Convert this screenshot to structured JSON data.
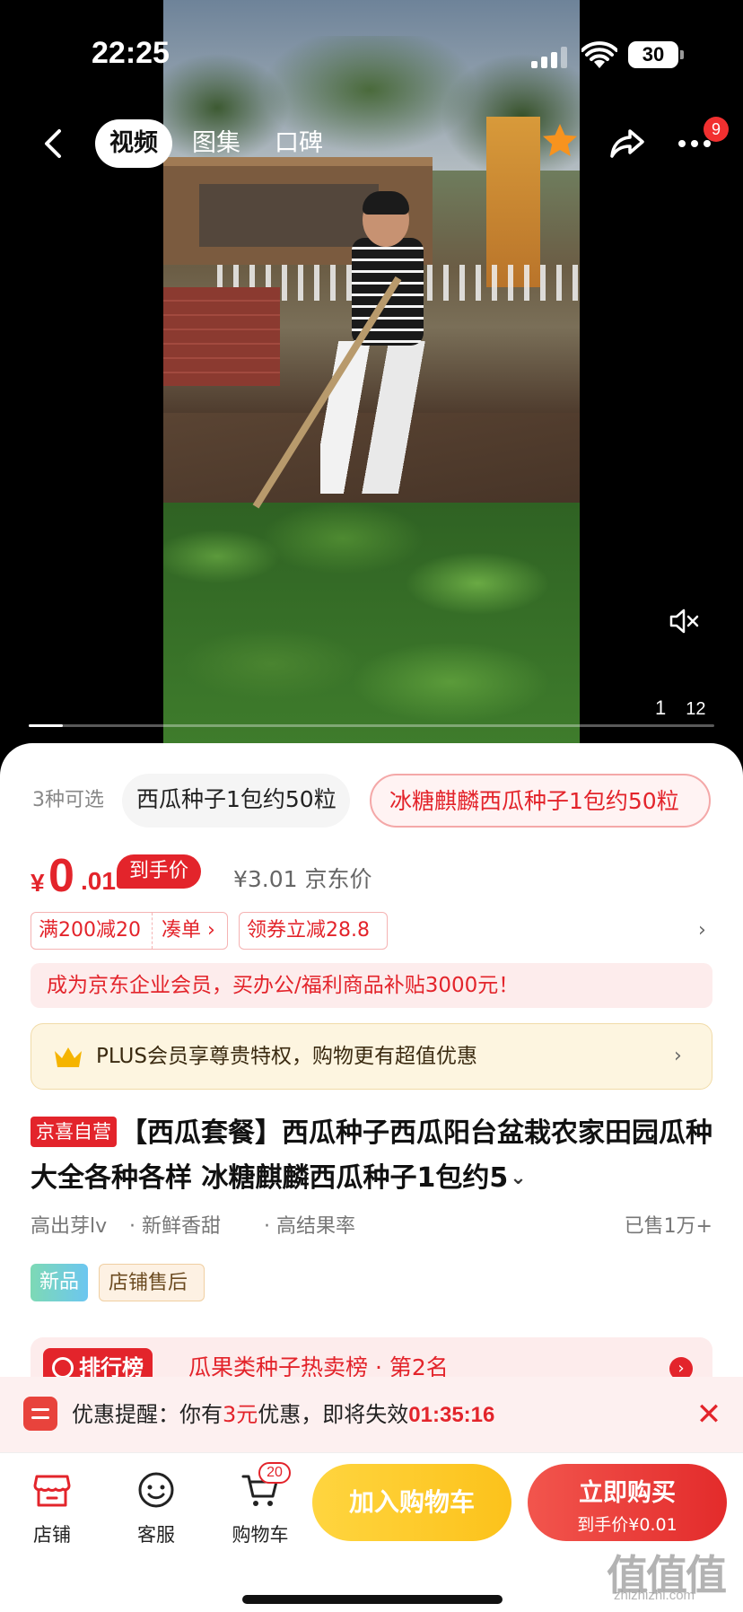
{
  "status_bar": {
    "time": "22:25",
    "battery": "30"
  },
  "nav": {
    "tabs": [
      {
        "label": "视频",
        "active": true
      },
      {
        "label": "图集",
        "active": false
      },
      {
        "label": "口碑",
        "active": false
      }
    ],
    "more_badge": "9"
  },
  "video": {
    "progress_fraction": 0.05,
    "page_current": "1",
    "page_total": "12"
  },
  "variants": {
    "count_label": "3种可选",
    "option1": "西瓜种子1包约50粒",
    "option2": "冰糖麒麟西瓜种子1包约50粒"
  },
  "price": {
    "symbol": "¥",
    "integer": "0",
    "decimal": ".01",
    "tag": "到手价",
    "reference": "¥3.01 京东价"
  },
  "promos": {
    "full_reduction": "满200减20",
    "combine": "凑单 ›",
    "coupon": "领券立减28.8",
    "arrow": "›"
  },
  "enterprise_banner": "成为京东企业会员，买办公/福利商品补贴3000元！",
  "plus_banner": {
    "text": "PLUS会员享尊贵特权，购物更有超值优惠",
    "arrow": "›"
  },
  "product": {
    "self_badge": "京喜自营",
    "title": "【西瓜套餐】西瓜种子西瓜阳台盆栽农家田园瓜种大全各种各样 冰糖麒麟西瓜种子1包约5",
    "expand": "⌄"
  },
  "features": {
    "f1": "高出芽lv",
    "f2": "· 新鲜香甜",
    "f3": "· 高结果率",
    "sold": "已售1万+"
  },
  "tags": {
    "new": "新品",
    "after_sale": "店铺售后"
  },
  "ranking": {
    "badge": "排行榜",
    "text": "瓜果类种子热卖榜 · 第2名",
    "arrow": "›"
  },
  "reminder": {
    "prefix": "优惠提醒：你有",
    "amount": "3元",
    "middle": "优惠，即将失效",
    "timer": "01:35:16",
    "close": "✕"
  },
  "bottom_bar": {
    "store": "店铺",
    "service": "客服",
    "cart": "购物车",
    "cart_badge": "20",
    "add_to_cart": "加入购物车",
    "buy_now": "立即购买",
    "buy_price": "到手价¥0.01"
  },
  "watermark": {
    "main": "值值值",
    "sub": "zhizhizhi.com"
  },
  "colors": {
    "accent": "#e3242b",
    "cart_button": "#fcc21b",
    "buy_button": "#e32b2b",
    "plus_bg": "#fdf5e0"
  },
  "icons": [
    "back-icon",
    "star-icon",
    "share-icon",
    "more-icon",
    "mute-icon",
    "crown-icon",
    "medal-icon",
    "store-icon",
    "service-icon",
    "cart-icon",
    "close-icon"
  ]
}
